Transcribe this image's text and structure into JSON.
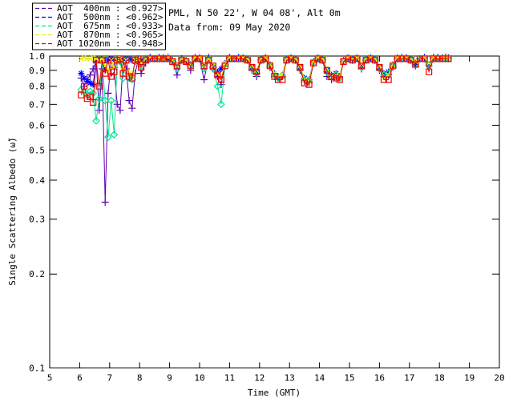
{
  "header": {
    "station_line": "PML, N 50 22', W 04 08', Alt 0m",
    "date_line": "Data from: 09 May 2020",
    "text_color": "#000080"
  },
  "colors": {
    "axis": "#000000",
    "background": "#ffffff",
    "aot400": "#5E00B0",
    "aot500": "#0000FF",
    "aot675": "#00E68C",
    "aot870": "#F0F000",
    "aot1020": "#EE0000"
  },
  "chart_data": {
    "type": "line",
    "title": "",
    "xlabel": "Time (GMT)",
    "ylabel": "Single Scattering Albedo (ω̃)",
    "xlim": [
      5,
      20
    ],
    "ylim": [
      0.1,
      1.0
    ],
    "yscale": "log",
    "grid": false,
    "legend_position": "top-left",
    "x_ticks": [
      5,
      6,
      7,
      8,
      9,
      10,
      11,
      12,
      13,
      14,
      15,
      16,
      17,
      18,
      19,
      20
    ],
    "y_ticks": [
      1.0,
      0.9,
      0.8,
      0.7,
      0.6,
      0.5,
      0.4,
      0.3,
      0.2,
      0.1
    ],
    "x": [
      6.05,
      6.15,
      6.25,
      6.35,
      6.45,
      6.55,
      6.65,
      6.75,
      6.85,
      6.95,
      7.05,
      7.15,
      7.25,
      7.35,
      7.45,
      7.55,
      7.65,
      7.75,
      7.85,
      7.95,
      8.05,
      8.2,
      8.35,
      8.5,
      8.65,
      8.8,
      8.95,
      9.1,
      9.25,
      9.4,
      9.55,
      9.7,
      9.85,
      10.0,
      10.15,
      10.3,
      10.45,
      10.6,
      10.72,
      10.85,
      11.0,
      11.15,
      11.3,
      11.45,
      11.6,
      11.75,
      11.9,
      12.05,
      12.2,
      12.35,
      12.5,
      12.62,
      12.76,
      12.9,
      13.05,
      13.2,
      13.35,
      13.5,
      13.65,
      13.8,
      13.95,
      14.1,
      14.25,
      14.4,
      14.55,
      14.67,
      14.8,
      14.95,
      15.1,
      15.25,
      15.4,
      15.55,
      15.7,
      15.85,
      16.0,
      16.15,
      16.3,
      16.45,
      16.6,
      16.75,
      16.9,
      17.05,
      17.2,
      17.35,
      17.5,
      17.65,
      17.8,
      17.95,
      18.1,
      18.2,
      18.3
    ],
    "series": [
      {
        "name": "AOT 400nm",
        "avg": "<0.927>",
        "legend_label": "AOT  400nm : <0.927>",
        "color": "#5E00B0",
        "marker": "plus",
        "values": [
          0.85,
          0.8,
          0.84,
          0.87,
          0.91,
          0.96,
          0.67,
          0.91,
          0.34,
          0.76,
          0.97,
          0.92,
          0.7,
          0.67,
          0.96,
          0.91,
          0.72,
          0.68,
          0.88,
          0.97,
          0.88,
          0.95,
          0.99,
          0.98,
          0.99,
          0.98,
          0.99,
          0.96,
          0.87,
          0.98,
          0.96,
          0.9,
          0.99,
          0.98,
          0.84,
          0.99,
          0.92,
          0.86,
          0.81,
          0.93,
          0.99,
          0.98,
          0.99,
          0.98,
          0.97,
          0.9,
          0.86,
          0.97,
          0.98,
          0.92,
          0.86,
          0.85,
          0.86,
          0.97,
          0.98,
          0.97,
          0.9,
          0.83,
          0.82,
          0.95,
          0.98,
          0.97,
          0.86,
          0.84,
          0.86,
          0.85,
          0.96,
          0.98,
          0.97,
          0.98,
          0.91,
          0.97,
          0.98,
          0.97,
          0.9,
          0.86,
          0.87,
          0.92,
          0.98,
          0.99,
          0.98,
          0.97,
          0.93,
          0.98,
          0.99,
          0.93,
          0.99,
          0.99,
          0.98,
          0.99,
          0.98
        ]
      },
      {
        "name": "AOT 500nm",
        "avg": "<0.962>",
        "legend_label": "AOT  500nm : <0.962>",
        "color": "#0000FF",
        "marker": "asterisk",
        "values": [
          0.88,
          0.85,
          0.83,
          0.82,
          0.81,
          0.97,
          0.98,
          0.97,
          0.9,
          0.97,
          0.98,
          0.97,
          0.96,
          0.97,
          0.98,
          0.97,
          0.98,
          0.97,
          0.96,
          0.98,
          0.97,
          0.98,
          0.99,
          0.98,
          0.99,
          0.99,
          0.98,
          0.97,
          0.92,
          0.98,
          0.97,
          0.94,
          0.98,
          0.99,
          0.92,
          0.98,
          0.92,
          0.89,
          0.91,
          0.95,
          0.99,
          0.98,
          0.99,
          0.99,
          0.98,
          0.92,
          0.89,
          0.98,
          0.99,
          0.94,
          0.88,
          0.86,
          0.87,
          0.98,
          0.99,
          0.98,
          0.92,
          0.85,
          0.84,
          0.96,
          0.99,
          0.98,
          0.9,
          0.87,
          0.88,
          0.86,
          0.97,
          0.99,
          0.98,
          0.99,
          0.93,
          0.98,
          0.99,
          0.98,
          0.92,
          0.88,
          0.89,
          0.94,
          0.99,
          0.99,
          0.99,
          0.98,
          0.95,
          0.98,
          0.99,
          0.94,
          0.99,
          0.99,
          0.99,
          0.99,
          0.99
        ]
      },
      {
        "name": "AOT 675nm",
        "avg": "<0.933>",
        "legend_label": "AOT  675nm : <0.933>",
        "color": "#00E68C",
        "marker": "diamond",
        "values": [
          0.78,
          0.77,
          0.75,
          0.77,
          0.76,
          0.62,
          0.73,
          0.97,
          0.72,
          0.55,
          0.72,
          0.56,
          0.97,
          0.96,
          0.85,
          0.97,
          0.85,
          0.84,
          0.97,
          0.98,
          0.93,
          0.97,
          0.98,
          0.98,
          0.98,
          0.98,
          0.98,
          0.96,
          0.91,
          0.97,
          0.96,
          0.93,
          0.98,
          0.98,
          0.91,
          0.97,
          0.91,
          0.8,
          0.7,
          0.94,
          0.98,
          0.98,
          0.98,
          0.98,
          0.97,
          0.91,
          0.88,
          0.97,
          0.98,
          0.93,
          0.87,
          0.85,
          0.86,
          0.97,
          0.98,
          0.97,
          0.91,
          0.84,
          0.83,
          0.95,
          0.98,
          0.97,
          0.89,
          0.86,
          0.87,
          0.85,
          0.96,
          0.98,
          0.97,
          0.98,
          0.92,
          0.97,
          0.98,
          0.97,
          0.91,
          0.87,
          0.88,
          0.93,
          0.98,
          0.98,
          0.98,
          0.97,
          0.94,
          0.98,
          0.98,
          0.93,
          0.98,
          0.98,
          0.98,
          0.98,
          0.98
        ]
      },
      {
        "name": "AOT 870nm",
        "avg": "<0.965>",
        "legend_label": "AOT  870nm : <0.965>",
        "color": "#F0F000",
        "marker": "cross",
        "values": [
          0.98,
          0.99,
          0.98,
          0.98,
          0.99,
          0.98,
          0.97,
          0.98,
          0.93,
          0.9,
          0.97,
          0.92,
          0.97,
          0.98,
          0.9,
          0.97,
          0.88,
          0.87,
          0.97,
          0.98,
          0.95,
          0.98,
          0.99,
          0.98,
          0.99,
          0.98,
          0.99,
          0.97,
          0.93,
          0.98,
          0.97,
          0.94,
          0.99,
          0.99,
          0.93,
          0.98,
          0.93,
          0.88,
          0.85,
          0.95,
          0.99,
          0.98,
          0.99,
          0.99,
          0.98,
          0.93,
          0.9,
          0.98,
          0.99,
          0.94,
          0.88,
          0.86,
          0.87,
          0.98,
          0.99,
          0.98,
          0.93,
          0.84,
          0.83,
          0.96,
          0.99,
          0.98,
          0.91,
          0.86,
          0.87,
          0.86,
          0.97,
          0.99,
          0.98,
          0.99,
          0.94,
          0.98,
          0.99,
          0.98,
          0.93,
          0.85,
          0.87,
          0.94,
          0.99,
          0.99,
          0.99,
          0.98,
          0.96,
          0.98,
          0.99,
          0.95,
          0.99,
          0.99,
          0.99,
          0.99,
          0.99
        ]
      },
      {
        "name": "AOT 1020nm",
        "avg": "<0.948>",
        "legend_label": "AOT 1020nm : <0.948>",
        "color": "#EE0000",
        "marker": "square",
        "values": [
          0.75,
          0.8,
          0.73,
          0.74,
          0.71,
          0.97,
          0.8,
          0.97,
          0.88,
          0.97,
          0.86,
          0.89,
          0.97,
          0.98,
          0.88,
          0.97,
          0.86,
          0.85,
          0.97,
          0.98,
          0.92,
          0.97,
          0.98,
          0.98,
          0.98,
          0.98,
          0.98,
          0.96,
          0.93,
          0.97,
          0.96,
          0.93,
          0.98,
          0.98,
          0.93,
          0.97,
          0.93,
          0.87,
          0.84,
          0.93,
          0.98,
          0.98,
          0.98,
          0.98,
          0.97,
          0.92,
          0.89,
          0.97,
          0.98,
          0.93,
          0.86,
          0.84,
          0.84,
          0.97,
          0.98,
          0.97,
          0.92,
          0.82,
          0.81,
          0.95,
          0.98,
          0.97,
          0.9,
          0.86,
          0.85,
          0.84,
          0.96,
          0.98,
          0.97,
          0.98,
          0.93,
          0.97,
          0.98,
          0.97,
          0.92,
          0.84,
          0.84,
          0.93,
          0.98,
          0.98,
          0.98,
          0.97,
          0.94,
          0.98,
          0.98,
          0.89,
          0.98,
          0.98,
          0.98,
          0.98,
          0.98
        ]
      }
    ]
  }
}
